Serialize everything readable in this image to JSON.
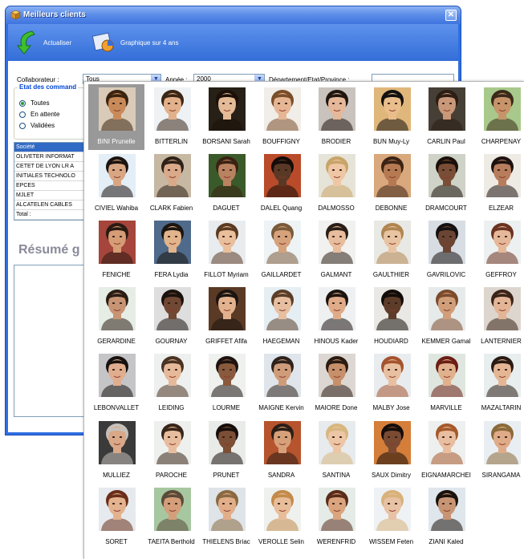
{
  "window": {
    "title": "Meilleurs clients",
    "close": "✕"
  },
  "toolbar": {
    "refresh_label": "Actualiser",
    "chart_label": "Graphique sur 4 ans"
  },
  "filters": {
    "collaborateur_label": "Collaborateur :",
    "collaborateur_value": "Tous",
    "annee_label": "Année :",
    "annee_value": "2000",
    "departement_label": "Département/Etat/Province :",
    "departement_value": ""
  },
  "etat": {
    "title": "Etat des command",
    "options": [
      {
        "label": "Toutes",
        "selected": true
      },
      {
        "label": "En attente",
        "selected": false
      },
      {
        "label": "Validées",
        "selected": false
      }
    ]
  },
  "table": {
    "header": "Société",
    "rows": [
      "OLIVETER INFORMAT",
      "CETET DE LYON LR A",
      "INITIALES TECHNOLO",
      "EPCES",
      "MJLET",
      "ALCATELEN CABLES"
    ],
    "total_label": "Total :"
  },
  "summary": {
    "title": "Résumé g"
  },
  "people": [
    {
      "name": "BINI Prunelle",
      "skin": "#c98a5a",
      "hair": "#3a2410",
      "bg": "#d9cbb8",
      "selected": true
    },
    {
      "name": "BITTERLIN",
      "skin": "#e2b08a",
      "hair": "#3b2616",
      "bg": "#eef2f5"
    },
    {
      "name": "BORSANI Sarah",
      "skin": "#e4bb97",
      "hair": "#1c1008",
      "bg": "#262017"
    },
    {
      "name": "BOUFFIGNY",
      "skin": "#e6b694",
      "hair": "#7a4e2a",
      "bg": "#f1ede8"
    },
    {
      "name": "BRODIER",
      "skin": "#e5b899",
      "hair": "#1f1610",
      "bg": "#c9c2bd"
    },
    {
      "name": "BUN Muy-Ly",
      "skin": "#e9be8c",
      "hair": "#121010",
      "bg": "#e0b77a"
    },
    {
      "name": "CARLIN Paul",
      "skin": "#c99878",
      "hair": "#2c1e14",
      "bg": "#463f36"
    },
    {
      "name": "CHARPENAY",
      "skin": "#c7946a",
      "hair": "#3a2a1a",
      "bg": "#a8c98b"
    },
    {
      "name": "CIVIEL Wahiba",
      "skin": "#d9a684",
      "hair": "#1b1411",
      "bg": "#e4eef7"
    },
    {
      "name": "CLARK Fabien",
      "skin": "#d9a98a",
      "hair": "#2d2118",
      "bg": "#c7b8a3"
    },
    {
      "name": "DAGUET",
      "skin": "#b98260",
      "hair": "#3a2212",
      "bg": "#3b5a2a"
    },
    {
      "name": "DALEL Quang",
      "skin": "#5a3826",
      "hair": "#140c08",
      "bg": "#b94b2a"
    },
    {
      "name": "DALMOSSO",
      "skin": "#efc7a4",
      "hair": "#c8a46a",
      "bg": "#e6e4d8"
    },
    {
      "name": "DEBONNE",
      "skin": "#b57a52",
      "hair": "#3a2314",
      "bg": "#d9a87c"
    },
    {
      "name": "DRAMCOURT",
      "skin": "#7a4e36",
      "hair": "#1a100b",
      "bg": "#cfd2c6"
    },
    {
      "name": "ELZEAR",
      "skin": "#b77d5c",
      "hair": "#1d1210",
      "bg": "#eeeae4"
    },
    {
      "name": "FENICHE",
      "skin": "#d59c76",
      "hair": "#2a1a12",
      "bg": "#a5453b"
    },
    {
      "name": "FERA Lydia",
      "skin": "#e2b48c",
      "hair": "#1c1510",
      "bg": "#4f6a8b"
    },
    {
      "name": "FILLOT Myriam",
      "skin": "#e9bf9c",
      "hair": "#5a3a22",
      "bg": "#e8ecef"
    },
    {
      "name": "GAILLARDET",
      "skin": "#d6a27c",
      "hair": "#7a5a3a",
      "bg": "#eef3f5"
    },
    {
      "name": "GALMANT",
      "skin": "#e7bd9d",
      "hair": "#2a1d15",
      "bg": "#f1f1ef"
    },
    {
      "name": "GAULTHIER",
      "skin": "#e9c4a2",
      "hair": "#b08550",
      "bg": "#e8e9e4"
    },
    {
      "name": "GAVRILOVIC",
      "skin": "#6a4533",
      "hair": "#151010",
      "bg": "#d7dde3"
    },
    {
      "name": "GEFFROY",
      "skin": "#e5b899",
      "hair": "#6a3220",
      "bg": "#edf0f0"
    },
    {
      "name": "GERARDINE",
      "skin": "#c79474",
      "hair": "#2a1d15",
      "bg": "#e6ede5"
    },
    {
      "name": "GOURNAY",
      "skin": "#714833",
      "hair": "#1a120d",
      "bg": "#dedede"
    },
    {
      "name": "GRIFFET Afifa",
      "skin": "#e2b28e",
      "hair": "#1c1410",
      "bg": "#5a3a25"
    },
    {
      "name": "HAEGEMAN",
      "skin": "#e7bfa0",
      "hair": "#5a3e28",
      "bg": "#e5eef3"
    },
    {
      "name": "HINOUS Kader",
      "skin": "#dfab89",
      "hair": "#1c1410",
      "bg": "#eef0f1"
    },
    {
      "name": "HOUDIARD",
      "skin": "#5e3c2a",
      "hair": "#120c09",
      "bg": "#eae8e4"
    },
    {
      "name": "KEMMER Gamal",
      "skin": "#d19e7a",
      "hair": "#7b4b2c",
      "bg": "#e6eaeb"
    },
    {
      "name": "LANTERNIER",
      "skin": "#e3b596",
      "hair": "#3a2418",
      "bg": "#dcd6cf"
    },
    {
      "name": "LEBONVALLET",
      "skin": "#e0ae8e",
      "hair": "#171210",
      "bg": "#c5c5c8"
    },
    {
      "name": "LEIDING",
      "skin": "#e5b999",
      "hair": "#4a3322",
      "bg": "#edf0ef"
    },
    {
      "name": "LOURME",
      "skin": "#8a5a3e",
      "hair": "#1d1310",
      "bg": "#eef1ed"
    },
    {
      "name": "MAIGNE Kervin",
      "skin": "#cf9c7a",
      "hair": "#2d221c",
      "bg": "#dfe5ea"
    },
    {
      "name": "MAIORE Done",
      "skin": "#c7906a",
      "hair": "#2a1b13",
      "bg": "#dcd7d2"
    },
    {
      "name": "MALBY Jose",
      "skin": "#e8bfa0",
      "hair": "#a4532e",
      "bg": "#e8ecef"
    },
    {
      "name": "MARVILLE",
      "skin": "#e1b08d",
      "hair": "#6a1e14",
      "bg": "#dfe6df"
    },
    {
      "name": "MAZALTARIN",
      "skin": "#e4b694",
      "hair": "#2a1b14",
      "bg": "#e8eded"
    },
    {
      "name": "MULLIEZ",
      "skin": "#d8a889",
      "hair": "#c6c0ba",
      "bg": "#3a3a3a"
    },
    {
      "name": "PAROCHE",
      "skin": "#e8bd9e",
      "hair": "#3a2618",
      "bg": "#eef0ee"
    },
    {
      "name": "PRUNET",
      "skin": "#7b4e36",
      "hair": "#160e0b",
      "bg": "#e9ebe8"
    },
    {
      "name": "SANDRA",
      "skin": "#d6a07a",
      "hair": "#2b1e16",
      "bg": "#b6542e"
    },
    {
      "name": "SANTINA",
      "skin": "#edc6a6",
      "hair": "#d7b780",
      "bg": "#e7ebee"
    },
    {
      "name": "SAUX Dimitry",
      "skin": "#7a4a33",
      "hair": "#150d0a",
      "bg": "#d57e3a"
    },
    {
      "name": "EIGNAMARCHEI",
      "skin": "#e9bea0",
      "hair": "#a55a2a",
      "bg": "#edf0ef"
    },
    {
      "name": "SIRANGAMA",
      "skin": "#e0ab88",
      "hair": "#8a6a3a",
      "bg": "#e9eef2"
    },
    {
      "name": "SORET",
      "skin": "#e3b28e",
      "hair": "#6a2e1a",
      "bg": "#e6eaee"
    },
    {
      "name": "TAEITA Berthold",
      "skin": "#d49e7a",
      "hair": "#5a4a3a",
      "bg": "#a7c7a0"
    },
    {
      "name": "THIELENS Briac",
      "skin": "#e2ae8a",
      "hair": "#8a6a42",
      "bg": "#dee4e8"
    },
    {
      "name": "VEROLLE Selin",
      "skin": "#e8bd9a",
      "hair": "#c38a4a",
      "bg": "#eef1ee"
    },
    {
      "name": "WERENFRID",
      "skin": "#d9a47e",
      "hair": "#5a2c1a",
      "bg": "#e5ece8"
    },
    {
      "name": "WISSEM Feten",
      "skin": "#e8c2a4",
      "hair": "#d8b27a",
      "bg": "#eef2f5"
    },
    {
      "name": "ZIANI Kaled",
      "skin": "#c89574",
      "hair": "#1a120d",
      "bg": "#dfe6ec"
    }
  ]
}
